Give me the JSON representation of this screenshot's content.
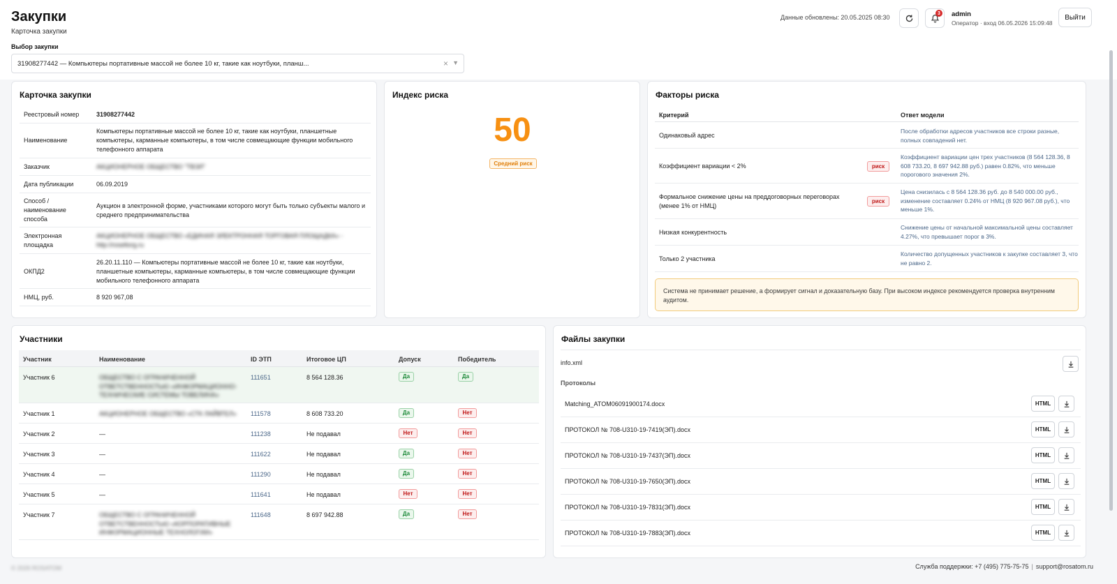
{
  "header": {
    "title": "Закупки",
    "subtitle": "Карточка закупки",
    "updated": "Данные обновлены: 20.05.2025 08:30",
    "notifications_count": "3",
    "user_name": "admin",
    "user_role": "Оператор · вход 06.05.2026 15:09:48",
    "logout_label": "Выйти"
  },
  "selector": {
    "label": "Выбор закупки",
    "value": "31908277442 — Компьютеры портативные массой не более 10 кг, такие как ноутбуки, планш..."
  },
  "card": {
    "title": "Карточка закупки",
    "fields": [
      {
        "key": "Реестровый номер",
        "value": "31908277442"
      },
      {
        "key": "Наименование",
        "value": "Компьютеры портативные массой не более 10 кг, такие как ноутбуки, планшетные компьютеры, карманные компьютеры, в том числе совмещающие функции мобильного телефонного аппарата"
      },
      {
        "key": "Заказчик",
        "value": "АКЦИОНЕРНОЕ ОБЩЕСТВО \"ТВЭЛ\""
      },
      {
        "key": "Дата публикации",
        "value": "06.09.2019"
      },
      {
        "key": "Способ / наименование способа",
        "value": "Аукцион в электронной форме, участниками которого могут быть только субъекты малого и среднего предпринимательства"
      },
      {
        "key": "Электронная площадка",
        "value": "АКЦИОНЕРНОЕ ОБЩЕСТВО «ЕДИНАЯ ЭЛЕКТРОННАЯ ТОРГОВАЯ ПЛОЩАДКА» - http://roseltorg.ru"
      },
      {
        "key": "ОКПД2",
        "value": "26.20.11.110 — Компьютеры портативные массой не более 10 кг, такие как ноутбуки, планшетные компьютеры, карманные компьютеры, в том числе совмещающие функции мобильного телефонного аппарата"
      },
      {
        "key": "НМЦ, руб.",
        "value": "8 920 967,08"
      }
    ]
  },
  "risk": {
    "title": "Индекс риска",
    "value": "50",
    "level": "Средний риск",
    "color": "#f79012"
  },
  "factors": {
    "title": "Факторы риска",
    "col_criterion": "Критерий",
    "col_answer": "Ответ модели",
    "risk_tag": "риск",
    "rows": [
      {
        "criterion": "Одинаковый адрес",
        "answer": "После обработки адресов участников все строки разные, полных совпадений нет."
      },
      {
        "criterion": "Коэффициент вариации < 2%",
        "answer": "Коэффициент вариации цен трех участников (8 564 128.36, 8 608 733.20, 8 697 942.88 руб.) равен 0.82%, что меньше порогового значения 2%."
      },
      {
        "criterion": "Формальное снижение цены на преддоговорных переговорах (менее 1% от НМЦ)",
        "answer": "Цена снизилась с 8 564 128.36 руб. до 8 540 000.00 руб., изменение составляет 0.24% от НМЦ (8 920 967.08 руб.), что меньше 1%."
      },
      {
        "criterion": "Низкая конкурентность",
        "answer": "Снижение цены от начальной максимальной цены составляет 4.27%, что превышает порог в 3%."
      },
      {
        "criterion": "Только 2 участника",
        "answer": "Количество допущенных участников к закупке составляет 3, что не равно 2."
      }
    ],
    "note": "Система не принимает решение, а формирует сигнал и доказательную базу. При высоком индексе рекомендуется проверка внутренним аудитом."
  },
  "participants": {
    "title": "Участники",
    "columns": [
      "Участник",
      "Наименование",
      "ID ЭТП",
      "Итоговое ЦП",
      "Допуск",
      "Победитель"
    ],
    "yes": "Да",
    "no": "Нет",
    "rows": [
      {
        "participant": "Участник 6",
        "name": "ОБЩЕСТВО С ОГРАНИЧЕННОЙ ОТВЕТСТВЕННОСТЬЮ «ИНФОРМАЦИОННО-ТЕХНИЧЕСКИЕ СИСТЕМЫ ТОВЕЛИНА»",
        "id": "111651",
        "price": "8 564 128.36"
      },
      {
        "participant": "Участник 1",
        "name": "АКЦИОНЕРНОЕ ОБЩЕСТВО «СТК ЛАЙВТЕЛ»",
        "id": "111578",
        "price": "8 608 733.20"
      },
      {
        "participant": "Участник 2",
        "name": "—",
        "id": "111238",
        "price": "Не подавал"
      },
      {
        "participant": "Участник 3",
        "name": "—",
        "id": "111622",
        "price": "Не подавал"
      },
      {
        "participant": "Участник 4",
        "name": "—",
        "id": "111290",
        "price": "Не подавал"
      },
      {
        "participant": "Участник 5",
        "name": "—",
        "id": "111641",
        "price": "Не подавал"
      },
      {
        "participant": "Участник 7",
        "name": "ОБЩЕСТВО С ОГРАНИЧЕННОЙ ОТВЕТСТВЕННОСТЬЮ «КОРПОРАТИВНЫЕ ИНФОРМАЦИОННЫЕ ТЕХНОЛОГИИ»",
        "id": "111648",
        "price": "8 697 942.88"
      }
    ]
  },
  "files": {
    "title": "Файлы закупки",
    "main_file": "info.xml",
    "protocols_label": "Протоколы",
    "html_label": "HTML",
    "protocols": [
      "Matching_ATOM06091900174.docx",
      "ПРОТОКОЛ № 708-U310-19-7419(ЭП).docx",
      "ПРОТОКОЛ № 708-U310-19-7437(ЭП).docx",
      "ПРОТОКОЛ № 708-U310-19-7650(ЭП).docx",
      "ПРОТОКОЛ № 708-U310-19-7831(ЭП).docx",
      "ПРОТОКОЛ № 708-U310-19-7883(ЭП).docx"
    ]
  },
  "footer": {
    "copyright": "© 2026 ROSATOM",
    "support": "Служба поддержки: +7 (495) 775-75-75",
    "separator": "|",
    "email": "support@rosatom.ru"
  }
}
